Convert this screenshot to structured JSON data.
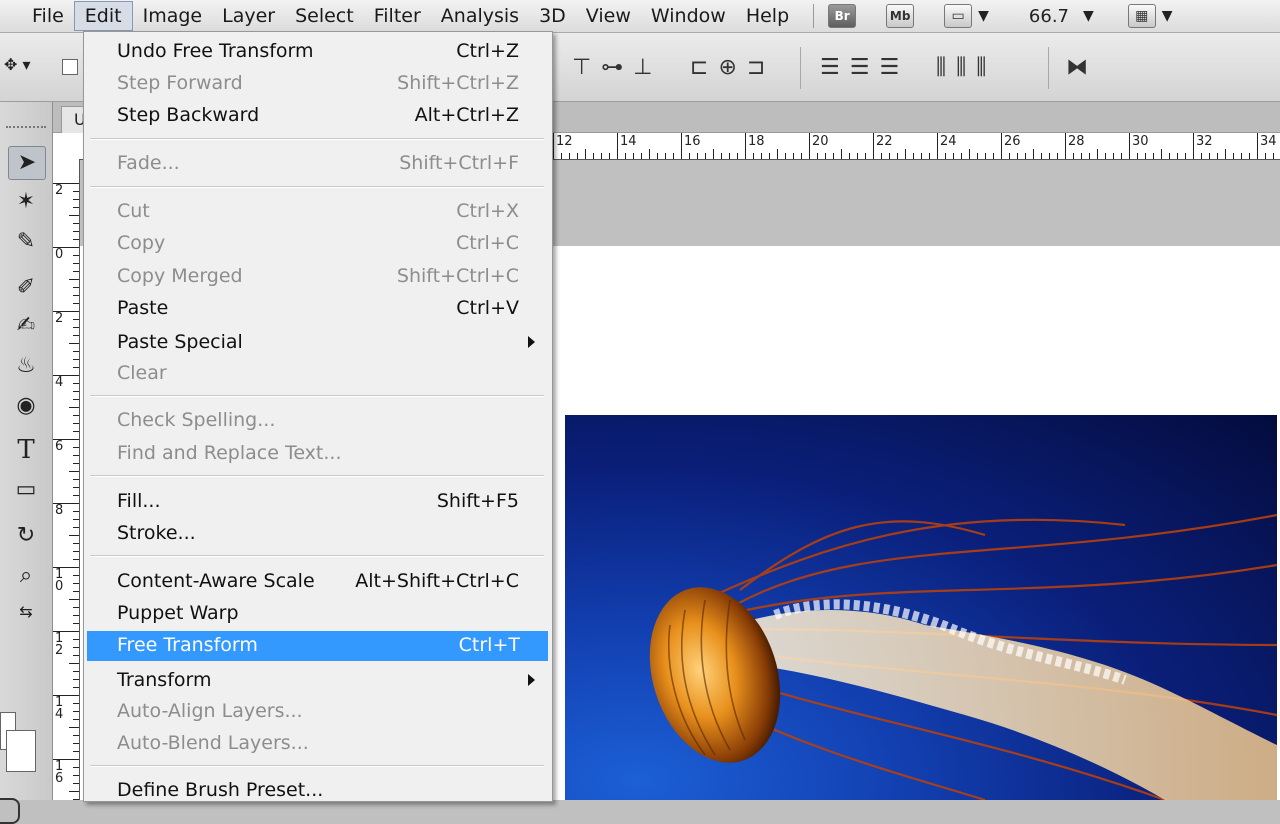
{
  "menubar": {
    "items": [
      "File",
      "Edit",
      "Image",
      "Layer",
      "Select",
      "Filter",
      "Analysis",
      "3D",
      "View",
      "Window",
      "Help"
    ],
    "bridge_label": "Br",
    "minibridge_label": "Mb",
    "zoom": "66.7"
  },
  "document": {
    "tab_label": "U"
  },
  "rulers": {
    "horizontal": [
      "12",
      "14",
      "16",
      "18",
      "20",
      "22",
      "24",
      "26",
      "28",
      "30",
      "32",
      "34"
    ],
    "vertical": [
      "2",
      "0",
      "2",
      "4",
      "6",
      "8",
      "10",
      "12",
      "14",
      "16"
    ]
  },
  "edit_menu": {
    "items": [
      {
        "label": "Undo Free Transform",
        "shortcut": "Ctrl+Z",
        "state": "enabled"
      },
      {
        "label": "Step Forward",
        "shortcut": "Shift+Ctrl+Z",
        "state": "disabled"
      },
      {
        "label": "Step Backward",
        "shortcut": "Alt+Ctrl+Z",
        "state": "enabled"
      },
      {
        "label": "Fade...",
        "shortcut": "Shift+Ctrl+F",
        "state": "disabled"
      },
      {
        "label": "Cut",
        "shortcut": "Ctrl+X",
        "state": "disabled"
      },
      {
        "label": "Copy",
        "shortcut": "Ctrl+C",
        "state": "disabled"
      },
      {
        "label": "Copy Merged",
        "shortcut": "Shift+Ctrl+C",
        "state": "disabled"
      },
      {
        "label": "Paste",
        "shortcut": "Ctrl+V",
        "state": "enabled"
      },
      {
        "label": "Paste Special",
        "shortcut": "",
        "state": "enabled",
        "submenu": true
      },
      {
        "label": "Clear",
        "shortcut": "",
        "state": "disabled"
      },
      {
        "label": "Check Spelling...",
        "shortcut": "",
        "state": "disabled"
      },
      {
        "label": "Find and Replace Text...",
        "shortcut": "",
        "state": "disabled"
      },
      {
        "label": "Fill...",
        "shortcut": "Shift+F5",
        "state": "enabled"
      },
      {
        "label": "Stroke...",
        "shortcut": "",
        "state": "enabled"
      },
      {
        "label": "Content-Aware Scale",
        "shortcut": "Alt+Shift+Ctrl+C",
        "state": "enabled"
      },
      {
        "label": "Puppet Warp",
        "shortcut": "",
        "state": "enabled"
      },
      {
        "label": "Free Transform",
        "shortcut": "Ctrl+T",
        "state": "highlight"
      },
      {
        "label": "Transform",
        "shortcut": "",
        "state": "enabled",
        "submenu": true
      },
      {
        "label": "Auto-Align Layers...",
        "shortcut": "",
        "state": "disabled"
      },
      {
        "label": "Auto-Blend Layers...",
        "shortcut": "",
        "state": "disabled"
      },
      {
        "label": "Define Brush Preset...",
        "shortcut": "",
        "state": "enabled"
      }
    ]
  },
  "tools": [
    "move-tool",
    "magic-wand-tool",
    "eyedropper-tool",
    "brush-tool",
    "history-brush-tool",
    "paint-bucket-tool",
    "sponge-tool",
    "type-tool",
    "rectangle-tool",
    "rotate-view-tool",
    "zoom-tool",
    "swap-colors-tool"
  ],
  "colors": {
    "menu_highlight": "#3399ff",
    "disabled_text": "#8d8d8d",
    "photo_blue": "#123fb0"
  }
}
